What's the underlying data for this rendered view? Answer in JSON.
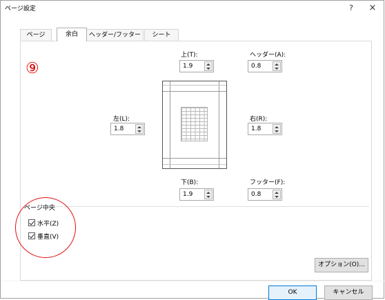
{
  "dialog": {
    "title": "ページ設定",
    "help_label": "?",
    "close_label": "×"
  },
  "tabs": [
    {
      "label": "ページ",
      "active": false
    },
    {
      "label": "余白",
      "active": true
    },
    {
      "label": "ヘッダー/フッター",
      "active": false
    },
    {
      "label": "シート",
      "active": false
    }
  ],
  "annotation": {
    "step_marker": "⑨",
    "highlight_color": "#e01010"
  },
  "margins": {
    "top": {
      "label": "上(T):",
      "value": "1.9"
    },
    "header": {
      "label": "ヘッダー(A):",
      "value": "0.8"
    },
    "left": {
      "label": "左(L):",
      "value": "1.8"
    },
    "right": {
      "label": "右(R):",
      "value": "1.8"
    },
    "bottom": {
      "label": "下(B):",
      "value": "1.9"
    },
    "footer": {
      "label": "フッター(F):",
      "value": "0.8"
    }
  },
  "center_on_page": {
    "group_label": "ページ中央",
    "horizontal": {
      "label": "水平(Z)",
      "checked": true
    },
    "vertical": {
      "label": "垂直(V)",
      "checked": true
    }
  },
  "buttons": {
    "options": "オプション(O)...",
    "ok": "OK",
    "cancel": "キャンセル"
  }
}
